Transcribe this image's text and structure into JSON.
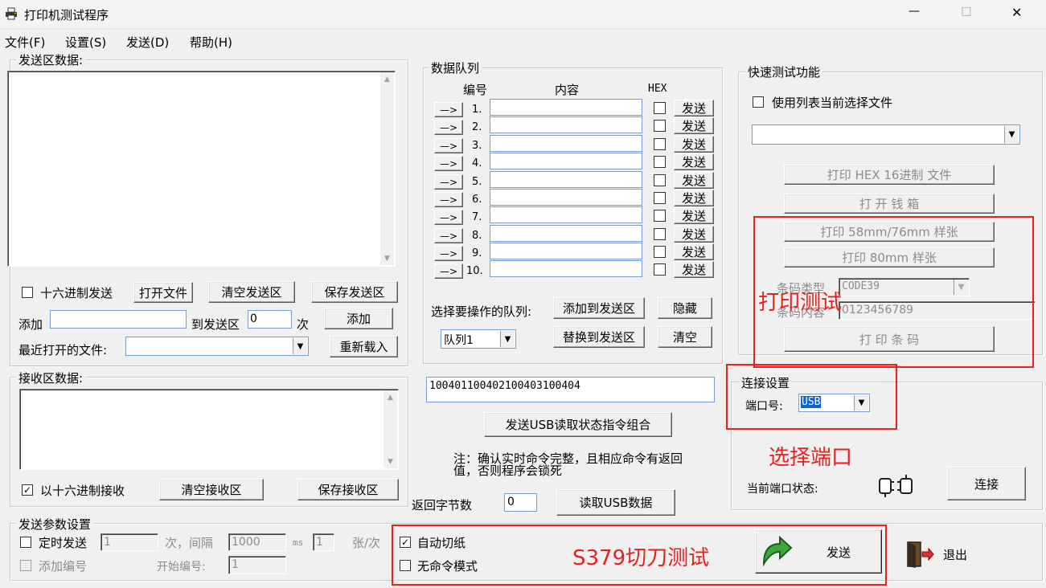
{
  "window": {
    "title": "打印机测试程序",
    "controls": {
      "minimize": "—",
      "maximize": "☐",
      "close": "✕"
    }
  },
  "menu": [
    "文件(F)",
    "设置(S)",
    "发送(D)",
    "帮助(H)"
  ],
  "send_area": {
    "label": "发送区数据:",
    "hex_send_label": "十六进制发送",
    "open_file": "打开文件",
    "clear_send": "清空发送区",
    "save_send": "保存发送区",
    "add_label": "添加",
    "to_send_area_label": "到发送区",
    "count_value": "0",
    "times_label": "次",
    "add_button": "添加",
    "recent_files_label": "最近打开的文件:",
    "reload": "重新载入"
  },
  "queue": {
    "label": "数据队列",
    "col_num": "编号",
    "col_content": "内容",
    "col_hex": "HEX",
    "arrow": "—>",
    "send": "发送",
    "rows": [
      "1.",
      "2.",
      "3.",
      "4.",
      "5.",
      "6.",
      "7.",
      "8.",
      "9.",
      "10."
    ],
    "select_label": "选择要操作的队列:",
    "add_to_send": "添加到发送区",
    "hide": "隐藏",
    "queue_select": "队列1",
    "replace_to_send": "替换到发送区",
    "clear": "清空"
  },
  "quick": {
    "label": "快速测试功能",
    "use_list_label": "使用列表当前选择文件",
    "print_hex": "打印 HEX 16进制 文件",
    "open_drawer": "打 开 钱 箱",
    "print_58": "打印 58mm/76mm 样张",
    "print_80": "打印 80mm 样张",
    "barcode_type_label": "条码类型",
    "barcode_type_value": "CODE39",
    "barcode_content_label": "条码内容",
    "barcode_content_value": "0123456789",
    "print_barcode": "打 印 条 码"
  },
  "receive": {
    "label": "接收区数据:",
    "hex_receive_label": "以十六进制接收",
    "hex_receive_checked": "✓",
    "clear_receive": "清空接收区",
    "save_receive": "保存接收区"
  },
  "usb": {
    "command_value": "100401100402100403100404",
    "send_combo": "发送USB读取状态指令组合",
    "note": "注：确认实时命令完整，且相应命令有返回值，否则程序会锁死",
    "return_bytes_label": "返回字节数",
    "return_bytes_value": "0",
    "read_usb": "读取USB数据"
  },
  "connection": {
    "label": "连接设置",
    "port_label": "端口号:",
    "port_value": "USB",
    "status_label": "当前端口状态:",
    "connect": "连接"
  },
  "send_params": {
    "label": "发送参数设置",
    "timed_send": "定时发送",
    "timed_value": "1",
    "times_interval": "次，间隔",
    "interval_value": "1000",
    "ms": "ms",
    "pages_value": "1",
    "pages_unit": "张/次",
    "add_number": "添加编号",
    "start_number_label": "开始编号:",
    "start_number_value": "1"
  },
  "bottom": {
    "auto_cut": "自动切纸",
    "auto_cut_checked": "✓",
    "no_command": "无命令模式",
    "send": "发送",
    "exit": "退出"
  },
  "annotations": {
    "print_test": "打印测试",
    "select_port": "选择端口",
    "cutter_test": "S379切刀测试",
    "color": "#e8201e"
  }
}
